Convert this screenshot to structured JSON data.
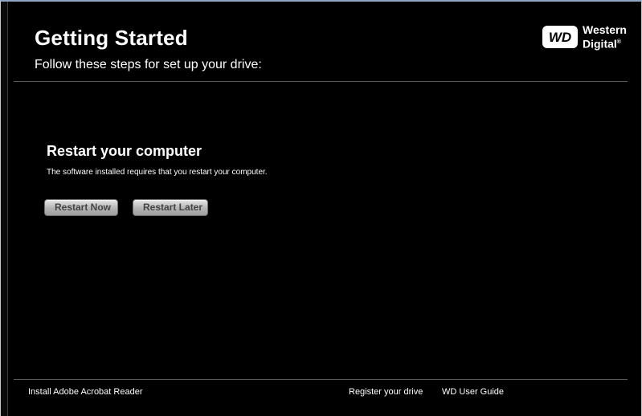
{
  "header": {
    "title": "Getting Started",
    "subtitle": "Follow these steps for set up your drive:",
    "logo": {
      "badge_text": "WD",
      "line1": "Western",
      "line2": "Digital",
      "trademark": "®"
    }
  },
  "main": {
    "heading": "Restart your computer",
    "body": "The software installed requires that you restart your computer.",
    "buttons": {
      "restart_now": "Restart Now",
      "restart_later": "Restart Later"
    }
  },
  "footer": {
    "links": {
      "acrobat": "Install Adobe Acrobat Reader",
      "register": "Register your drive",
      "guide": "WD User Guide"
    }
  },
  "colors": {
    "background": "#000000",
    "text": "#ffffff",
    "divider": "#5a5a5a",
    "button_text": "#444444"
  },
  "icons": {
    "logo": "wd-logo-icon"
  }
}
